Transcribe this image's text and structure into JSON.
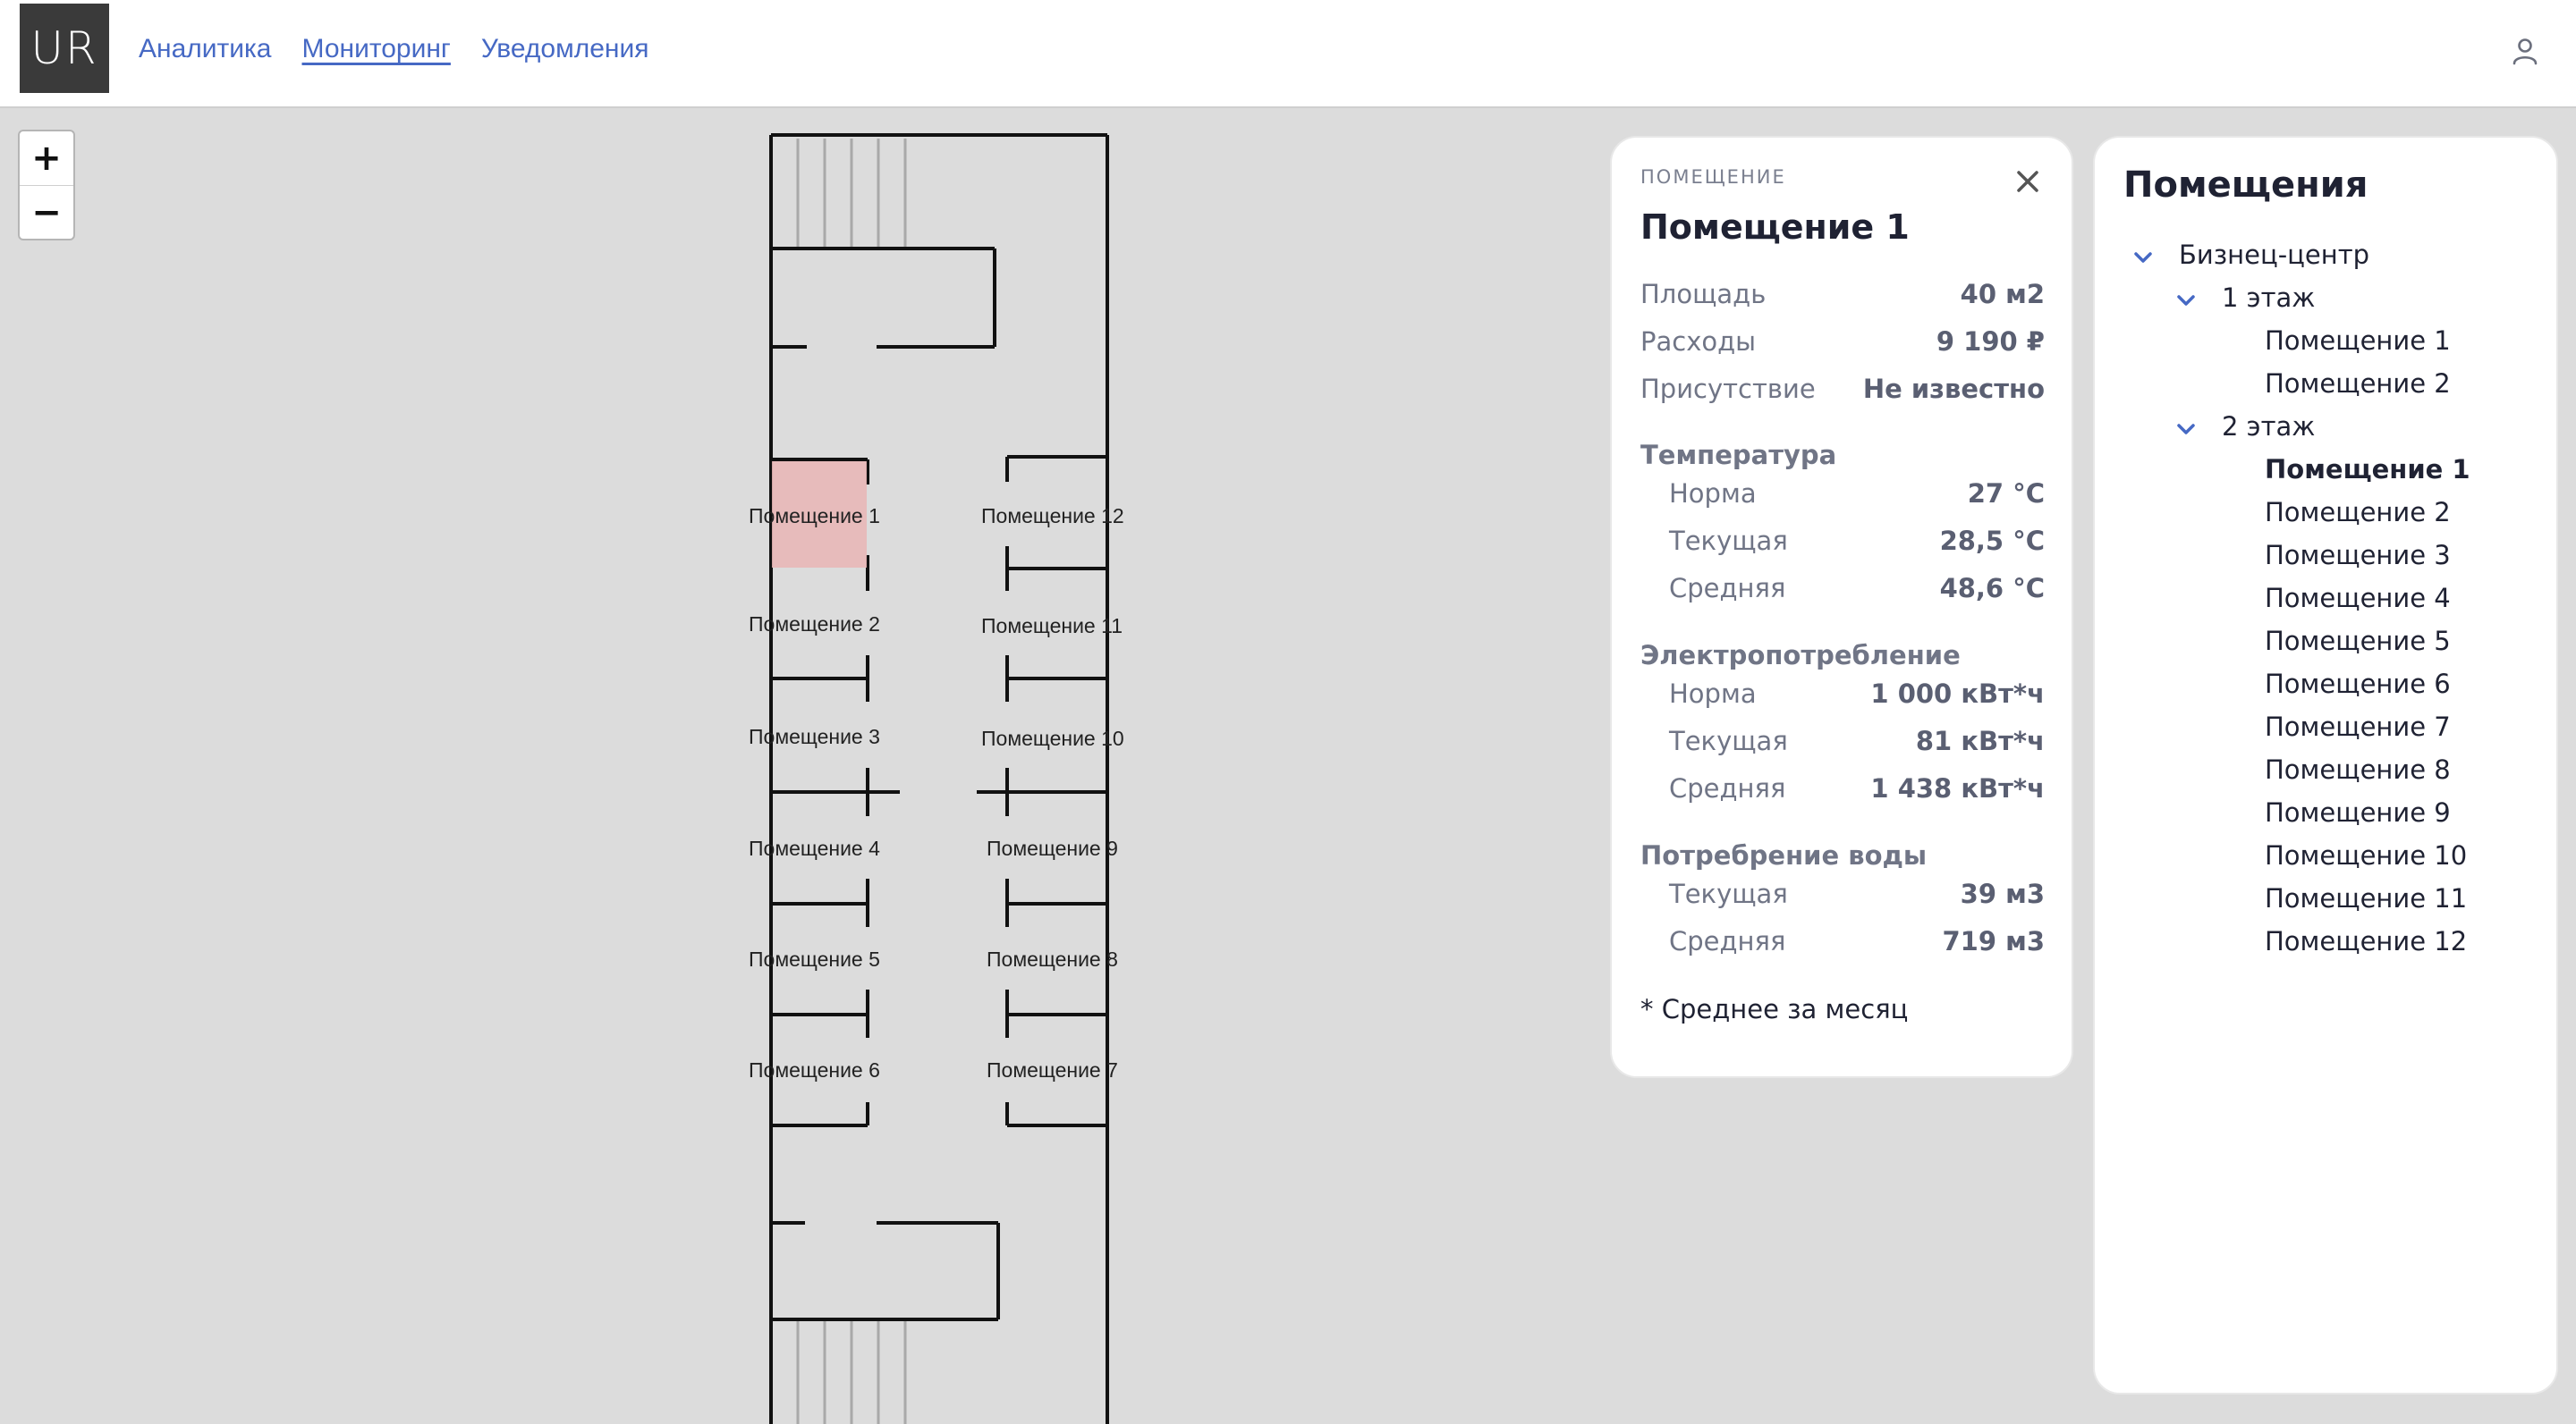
{
  "header": {
    "logo_text": "UR",
    "nav": [
      "Аналитика",
      "Мониторинг",
      "Уведомления"
    ],
    "active_nav": "Мониторинг",
    "user_icon": "user-icon"
  },
  "map": {
    "zoom_in": "+",
    "zoom_out": "−",
    "selected_room_color": "#e8b7b7",
    "rooms": [
      "Помещение 1",
      "Помещение 2",
      "Помещение 3",
      "Помещение 4",
      "Помещение 5",
      "Помещение 6",
      "Помещение 7",
      "Помещение 8",
      "Помещение 9",
      "Помещение 10",
      "Помещение 11",
      "Помещение 12"
    ]
  },
  "panel": {
    "kicker": "ПОМЕЩЕНИЕ",
    "title": "Помещение 1",
    "close_icon": "close-icon",
    "summary": [
      {
        "label": "Площадь",
        "value": "40 м2"
      },
      {
        "label": "Расходы",
        "value": "9 190 ₽"
      },
      {
        "label": "Присутствие",
        "value": "Не известно"
      }
    ],
    "temperature": {
      "title": "Температура",
      "rows": [
        {
          "label": "Норма",
          "value": "27 °C"
        },
        {
          "label": "Текущая",
          "value": "28,5 °C"
        },
        {
          "label": "Средняя",
          "value": "48,6 °C"
        }
      ]
    },
    "power": {
      "title": "Электропотребление",
      "rows": [
        {
          "label": "Норма",
          "value": "1 000 кВт*ч"
        },
        {
          "label": "Текущая",
          "value": "81 кВт*ч"
        },
        {
          "label": "Средняя",
          "value": "1 438 кВт*ч"
        }
      ]
    },
    "water": {
      "title": "Потребрение воды",
      "rows": [
        {
          "label": "Текущая",
          "value": "39 м3"
        },
        {
          "label": "Средняя",
          "value": "719 м3"
        }
      ]
    },
    "footnote": "* Среднее за месяц"
  },
  "tree": {
    "title": "Помещения",
    "building": "Бизнец-центр",
    "floor1": "1 этаж",
    "floor1_rooms": [
      "Помещение 1",
      "Помещение 2"
    ],
    "floor2": "2 этаж",
    "floor2_rooms": [
      "Помещение 1",
      "Помещение 2",
      "Помещение 3",
      "Помещение 4",
      "Помещение 5",
      "Помещение 6",
      "Помещение 7",
      "Помещение 8",
      "Помещение 9",
      "Помещение 10",
      "Помещение 11",
      "Помещение 12"
    ],
    "selected": "Помещение 1",
    "chevron_icon": "chevron-down-icon",
    "accent": "#4669c4"
  }
}
